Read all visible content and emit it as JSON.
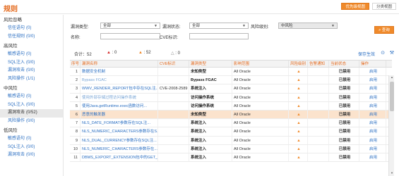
{
  "header": {
    "title": "规则",
    "tabs": [
      {
        "label": "优先级视图",
        "active": true
      },
      {
        "label": "分类视图",
        "active": false
      }
    ]
  },
  "sidebar": {
    "groups": [
      {
        "title": "风险忽略",
        "items": [
          {
            "label": "信任语句",
            "count": "(0)"
          },
          {
            "label": "信任规则",
            "count": "(0/0)"
          }
        ]
      },
      {
        "title": "高风险",
        "items": [
          {
            "label": "敏感语句",
            "count": "(0)"
          },
          {
            "label": "SQL注入",
            "count": "(0/0)"
          },
          {
            "label": "漏洞攻击",
            "count": "(0/0)"
          },
          {
            "label": "风险操作",
            "count": "(1/1)"
          }
        ]
      },
      {
        "title": "中风险",
        "items": [
          {
            "label": "敏感语句",
            "count": "(0)"
          },
          {
            "label": "SQL注入",
            "count": "(0/0)"
          },
          {
            "label": "漏洞攻击",
            "count": "(0/52)",
            "active": true
          },
          {
            "label": "风险操作",
            "count": "(0/0)"
          }
        ]
      },
      {
        "title": "低风险",
        "items": [
          {
            "label": "敏感语句",
            "count": "(0)"
          },
          {
            "label": "SQL注入",
            "count": "(0/0)"
          },
          {
            "label": "漏洞攻击",
            "count": "(0/0)"
          }
        ]
      }
    ]
  },
  "filter": {
    "type_label": "漏洞类型:",
    "type_value": "全部",
    "status_label": "漏洞状态:",
    "status_value": "全部",
    "risk_label": "风险级别:",
    "risk_value": "中风险",
    "name_label": "名称:",
    "name_value": "",
    "cve_label": "CVE标识:",
    "cve_value": "",
    "query_label": "查询",
    "query_icon": "search-icon"
  },
  "summary": {
    "total_label": "合计：",
    "total": "52",
    "high": "0",
    "mid": "52",
    "low": "0",
    "save_label": "保存生效",
    "colors": {
      "accent": "#f08a2a",
      "link": "#2b6fc2",
      "danger": "#d52b2b"
    }
  },
  "table": {
    "headers": [
      "序号",
      "漏洞名称",
      "CVE标识",
      "漏洞类型",
      "影响范围",
      "风险级别",
      "告警通知",
      "当前状态",
      "操作"
    ],
    "rows": [
      {
        "no": "1",
        "name": "数据安全机制",
        "cve": "",
        "type": "未知类型",
        "scope": "All Oracle",
        "status": "已禁用",
        "op": "启用"
      },
      {
        "no": "2",
        "name": "Bypass FGAC",
        "cve": "",
        "type": "Bypass FGAC",
        "scope": "All Oracle",
        "status": "已禁用",
        "op": "启用"
      },
      {
        "no": "3",
        "name": "WWV_RENDER_REPORT包中存在SQL注...",
        "cve": "CVE-2008-2589",
        "type": "系统注入",
        "scope": "All Oracle",
        "status": "已禁用",
        "op": "启用"
      },
      {
        "no": "4",
        "name": "使用外部存储过程访问操作系统",
        "cve": "",
        "type": "访问操作系统",
        "scope": "All Oracle",
        "status": "已禁用",
        "op": "启用"
      },
      {
        "no": "5",
        "name": "使用Java.getRuntime.exec函数访问...",
        "cve": "",
        "type": "访问操作系统",
        "scope": "All Oracle",
        "status": "已禁用",
        "op": "启用"
      },
      {
        "no": "6",
        "name": "恶意的触发器",
        "cve": "",
        "type": "未知类型",
        "scope": "All Oracle",
        "status": "已禁用",
        "op": "启用",
        "hl": true
      },
      {
        "no": "7",
        "name": "NLS_DATE_FORMAT参数存在SQL注...",
        "cve": "",
        "type": "系统注入",
        "scope": "All Oracle",
        "status": "已禁用",
        "op": "启用"
      },
      {
        "no": "8",
        "name": "NLS_NUMERIC_CHARACTERS参数存在S...",
        "cve": "",
        "type": "系统注入",
        "scope": "All Oracle",
        "status": "已禁用",
        "op": "启用"
      },
      {
        "no": "9",
        "name": "NLS_DUAL_CURRENCY参数存在SQL注...",
        "cve": "",
        "type": "系统注入",
        "scope": "All Oracle",
        "status": "已禁用",
        "op": "启用"
      },
      {
        "no": "10",
        "name": "NLS_NUMERIC_CHARACTERS参数存在...",
        "cve": "",
        "type": "系统注入",
        "scope": "All Oracle",
        "status": "已禁用",
        "op": "启用"
      },
      {
        "no": "11",
        "name": "DBMS_EXPORT_EXTENSION包中的GET_...",
        "cve": "",
        "type": "系统注入",
        "scope": "All Oracle",
        "status": "已禁用",
        "op": "启用"
      }
    ]
  }
}
